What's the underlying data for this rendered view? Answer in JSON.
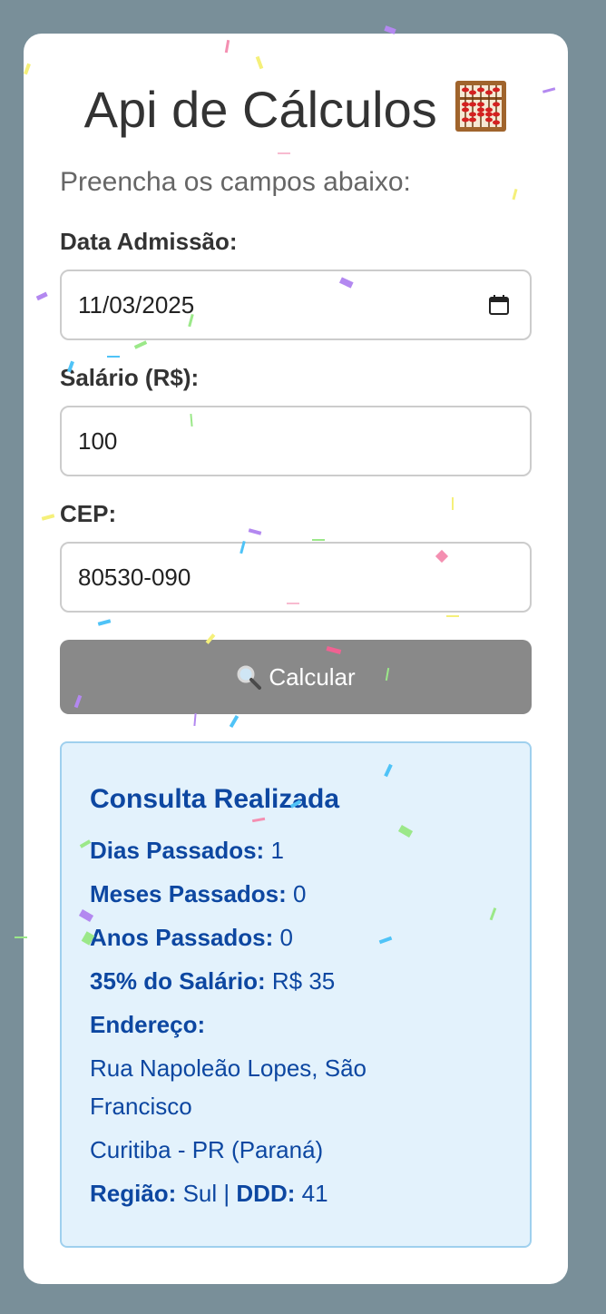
{
  "app": {
    "title": "Api de Cálculos",
    "subtitle": "Preencha os campos abaixo:"
  },
  "icons": {
    "title_icon": "abacus-icon",
    "calendar_icon": "calendar-icon",
    "button_icon": "magnifier-icon"
  },
  "form": {
    "admission": {
      "label": "Data Admissão:",
      "value": "11/03/2025"
    },
    "salary": {
      "label": "Salário (R$):",
      "value": "100"
    },
    "cep": {
      "label": "CEP:",
      "value": "80530-090"
    },
    "submit_label": "Calcular"
  },
  "result": {
    "heading": "Consulta Realizada",
    "days": {
      "label": "Dias Passados:",
      "value": "1"
    },
    "months": {
      "label": "Meses Passados:",
      "value": "0"
    },
    "years": {
      "label": "Anos Passados:",
      "value": "0"
    },
    "salary_pct": {
      "label": "35% do Salário:",
      "value": "R$ 35"
    },
    "address": {
      "label": "Endereço:",
      "street": "Rua Napoleão Lopes, São",
      "district": "Francisco",
      "city_state": "Curitiba - PR (Paraná)"
    },
    "region": {
      "label": "Região:",
      "value": "Sul",
      "separator": "|",
      "ddd_label": "DDD:",
      "ddd_value": "41"
    }
  },
  "colors": {
    "background": "#798f99",
    "card": "#ffffff",
    "button": "#898989",
    "result_bg": "#e3f2fc",
    "result_border": "#9fd0ee",
    "result_text": "#0d47a1"
  }
}
